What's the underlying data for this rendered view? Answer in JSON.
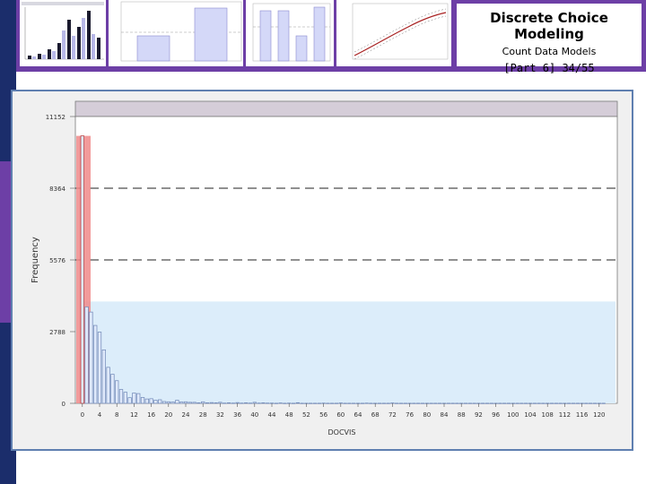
{
  "slide": {
    "title": "Discrete Choice Modeling",
    "subtitle": "Count Data Models",
    "page": "[Part 6]   34/55"
  },
  "colors": {
    "accent_purple": "#6d3fa6",
    "navy": "#1b2d6b",
    "bar_fill": "#dfe9fb",
    "bar_stroke": "#6e86b5",
    "highlight_red": "#f08a8a",
    "shaded_region": "#dcedfa"
  },
  "chart_data": {
    "type": "bar",
    "xlabel": "DOCVIS",
    "ylabel": "Frequency",
    "ylim": [
      0,
      11152
    ],
    "y_ticks": [
      0,
      2788,
      5576,
      8364,
      11152
    ],
    "y_tick_labels": [
      "0",
      "2788",
      "5576",
      "8364",
      "11152"
    ],
    "dashed_gridlines_at": [
      5576,
      8364
    ],
    "shaded_region": {
      "x_from": 1,
      "x_to": 121,
      "y_from": 0,
      "y_to": 3960
    },
    "highlighted_bars": [
      0
    ],
    "x_tick_labels": [
      "0",
      "4",
      "8",
      "12",
      "16",
      "20",
      "24",
      "28",
      "32",
      "36",
      "40",
      "44",
      "48",
      "52",
      "56",
      "60",
      "64",
      "68",
      "72",
      "76",
      "80",
      "84",
      "88",
      "92",
      "96",
      "100",
      "104",
      "108",
      "112",
      "116",
      "120"
    ],
    "categories": [
      0,
      1,
      2,
      3,
      4,
      5,
      6,
      7,
      8,
      9,
      10,
      11,
      12,
      13,
      14,
      15,
      16,
      17,
      18,
      19,
      20,
      21,
      22,
      23,
      24,
      25,
      26,
      27,
      28,
      29,
      30,
      31,
      32,
      33,
      34,
      35,
      36,
      37,
      38,
      39,
      40,
      41,
      42,
      43,
      44,
      45,
      46,
      47,
      48,
      49,
      50,
      51,
      52,
      53,
      54,
      55,
      56,
      57,
      58,
      59,
      60,
      61,
      62,
      63,
      64,
      65,
      66,
      67,
      68,
      69,
      70,
      71,
      72,
      73,
      74,
      75,
      76,
      77,
      78,
      79,
      80,
      81,
      82,
      83,
      84,
      85,
      86,
      87,
      88,
      89,
      90,
      91,
      92,
      93,
      94,
      95,
      96,
      97,
      98,
      99,
      100,
      101,
      102,
      103,
      104,
      105,
      106,
      107,
      108,
      109,
      110,
      111,
      112,
      113,
      114,
      115,
      116,
      117,
      118,
      119,
      120,
      121
    ],
    "values": [
      10400,
      3750,
      3550,
      3030,
      2770,
      2080,
      1400,
      1130,
      880,
      540,
      430,
      220,
      400,
      380,
      230,
      170,
      180,
      120,
      140,
      70,
      60,
      50,
      120,
      50,
      60,
      40,
      40,
      20,
      60,
      20,
      30,
      20,
      40,
      10,
      20,
      10,
      30,
      10,
      20,
      10,
      40,
      10,
      20,
      10,
      10,
      5,
      15,
      5,
      10,
      5,
      25,
      5,
      5,
      5,
      5,
      5,
      10,
      5,
      5,
      5,
      15,
      5,
      5,
      5,
      5,
      5,
      10,
      5,
      5,
      5,
      5,
      5,
      15,
      5,
      5,
      5,
      5,
      5,
      5,
      5,
      5,
      5,
      5,
      5,
      5,
      5,
      5,
      5,
      5,
      5,
      5,
      5,
      5,
      5,
      5,
      5,
      5,
      5,
      5,
      5,
      5,
      5,
      5,
      5,
      5,
      5,
      5,
      5,
      5,
      5,
      5,
      5,
      5,
      5,
      5,
      5,
      5,
      5,
      5,
      5,
      5,
      5
    ]
  }
}
